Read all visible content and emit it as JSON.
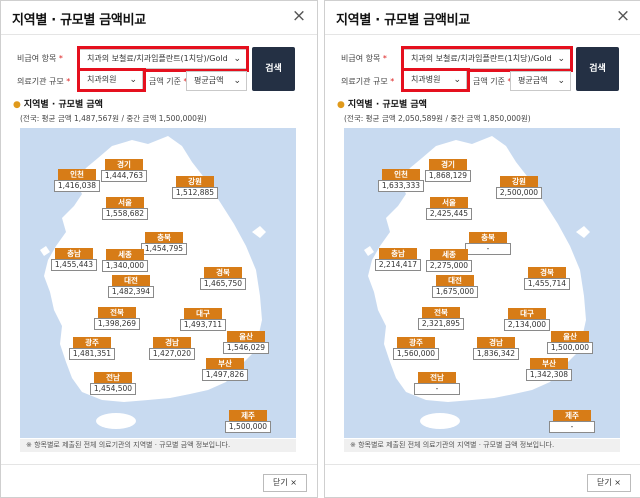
{
  "panels": [
    {
      "title": "지역별 · 규모별 금액비교",
      "close_symbol": "×",
      "item_label": "비급여 항목",
      "item_value": "치과의 보철료/치과임플란트(1치당)/Gold",
      "size_label": "의료기관 규모",
      "size_value": "치과의원",
      "basis_label": "금액 기준",
      "basis_value": "평균금액",
      "search_label": "검색",
      "section_title": "지역별 · 규모별 금액",
      "summary": "(전국: 평균 금액 1,487,567원 / 중간 금액 1,500,000원)",
      "regions": [
        {
          "name": "인천",
          "value": "1,416,038"
        },
        {
          "name": "경기",
          "value": "1,444,763"
        },
        {
          "name": "강원",
          "value": "1,512,885"
        },
        {
          "name": "서울",
          "value": "1,558,682"
        },
        {
          "name": "충북",
          "value": "1,454,795"
        },
        {
          "name": "충남",
          "value": "1,455,443"
        },
        {
          "name": "세종",
          "value": "1,340,000"
        },
        {
          "name": "대전",
          "value": "1,482,394"
        },
        {
          "name": "경북",
          "value": "1,465,750"
        },
        {
          "name": "전북",
          "value": "1,398,269"
        },
        {
          "name": "대구",
          "value": "1,493,711"
        },
        {
          "name": "광주",
          "value": "1,481,351"
        },
        {
          "name": "경남",
          "value": "1,427,020"
        },
        {
          "name": "울산",
          "value": "1,546,029"
        },
        {
          "name": "부산",
          "value": "1,497,826"
        },
        {
          "name": "전남",
          "value": "1,454,500"
        },
        {
          "name": "제주",
          "value": "1,500,000"
        }
      ],
      "note": "※ 항목별로 제출된 전체 의료기관의 지역별 · 규모별 금액 정보입니다.",
      "close_label": "닫기 ×"
    },
    {
      "title": "지역별 · 규모별 금액비교",
      "close_symbol": "×",
      "item_label": "비급여 항목",
      "item_value": "치과의 보철료/치과임플란트(1치당)/Gold",
      "size_label": "의료기관 규모",
      "size_value": "치과병원",
      "basis_label": "금액 기준",
      "basis_value": "평균금액",
      "search_label": "검색",
      "section_title": "지역별 · 규모별 금액",
      "summary": "(전국: 평균 금액 2,050,589원 / 중간 금액 1,850,000원)",
      "regions": [
        {
          "name": "인천",
          "value": "1,633,333"
        },
        {
          "name": "경기",
          "value": "1,868,129"
        },
        {
          "name": "강원",
          "value": "2,500,000"
        },
        {
          "name": "서울",
          "value": "2,425,445"
        },
        {
          "name": "충북",
          "value": "-"
        },
        {
          "name": "충남",
          "value": "2,214,417"
        },
        {
          "name": "세종",
          "value": "2,275,000"
        },
        {
          "name": "대전",
          "value": "1,675,000"
        },
        {
          "name": "경북",
          "value": "1,455,714"
        },
        {
          "name": "전북",
          "value": "2,321,895"
        },
        {
          "name": "대구",
          "value": "2,134,000"
        },
        {
          "name": "광주",
          "value": "1,560,000"
        },
        {
          "name": "경남",
          "value": "1,836,342"
        },
        {
          "name": "울산",
          "value": "1,500,000"
        },
        {
          "name": "부산",
          "value": "1,342,308"
        },
        {
          "name": "전남",
          "value": "-"
        },
        {
          "name": "제주",
          "value": "-"
        }
      ],
      "note": "※ 항목별로 제출된 전체 의료기관의 지역별 · 규모별 금액 정보입니다.",
      "close_label": "닫기 ×"
    }
  ],
  "colors": {
    "highlight": "#e5101e",
    "region_tag": "#d77c17",
    "search_button": "#243044",
    "sea": "#c8daf0",
    "land": "#ffffff"
  }
}
